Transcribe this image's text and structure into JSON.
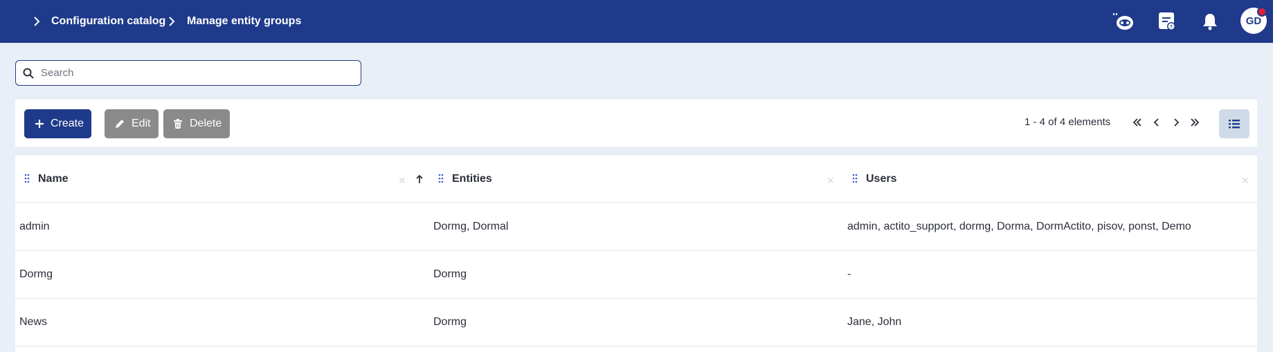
{
  "header": {
    "breadcrumb": [
      "Configuration catalog",
      "Manage entity groups"
    ],
    "icons": [
      "chatbot-icon",
      "help-icon",
      "bell-icon"
    ],
    "user_initials": "GD",
    "brand_color": "#1f3a8a",
    "notification_dot_color": "#e0203a"
  },
  "search": {
    "placeholder": "Search",
    "value": ""
  },
  "toolbar": {
    "create_label": "Create",
    "edit_label": "Edit",
    "delete_label": "Delete",
    "pagination_text": "1 - 4 of 4 elements"
  },
  "table": {
    "columns": [
      {
        "label": "Name",
        "sort": "ascending"
      },
      {
        "label": "Entities"
      },
      {
        "label": "Users"
      }
    ],
    "rows": [
      {
        "name": "admin",
        "entities": "Dormg, Dormal",
        "users": "admin, actito_support, dormg, Dorma, DormActito, pisov, ponst, Demo"
      },
      {
        "name": "Dormg",
        "entities": "Dormg",
        "users": "-"
      },
      {
        "name": "News",
        "entities": "Dormg",
        "users": "Jane, John"
      }
    ]
  }
}
